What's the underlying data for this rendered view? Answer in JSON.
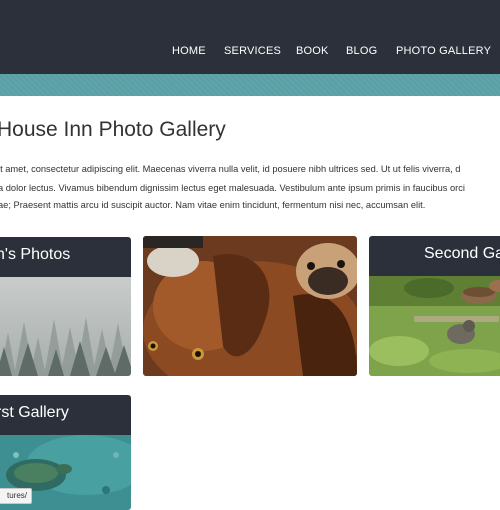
{
  "nav": {
    "items": [
      {
        "label": "HOME"
      },
      {
        "label": "SERVICES"
      },
      {
        "label": "BOOK"
      },
      {
        "label": "BLOG"
      },
      {
        "label": "PHOTO GALLERY"
      }
    ]
  },
  "page": {
    "title": "House Inn Photo Gallery",
    "paragraph": [
      "it amet, consectetur adipiscing elit. Maecenas viverra nulla velit, id posuere nibh ultrices sed. Ut ut felis viverra, d",
      "a dolor lectus. Vivamus bibendum dignissim lectus eget malesuada. Vestibulum ante ipsum primis in faucibus orci",
      "ae; Praesent mattis arcu id suscipit auctor. Nam vitae enim tincidunt, fermentum nisi nec, accumsan elit."
    ]
  },
  "gallery": {
    "cards": [
      {
        "title": "n's Photos",
        "image": "misty-forest-photo"
      },
      {
        "title": "",
        "image": "dogs-photo"
      },
      {
        "title": "Second Ga",
        "image": "garden-cat-photo"
      },
      {
        "title": "rst Gallery",
        "image": "underwater-turtle-photo"
      }
    ]
  },
  "status": {
    "url": "tures/"
  },
  "colors": {
    "header": "#2b303a",
    "stripe": "#5aa0a6",
    "text": "#333333",
    "nav_text": "#ffffff"
  }
}
